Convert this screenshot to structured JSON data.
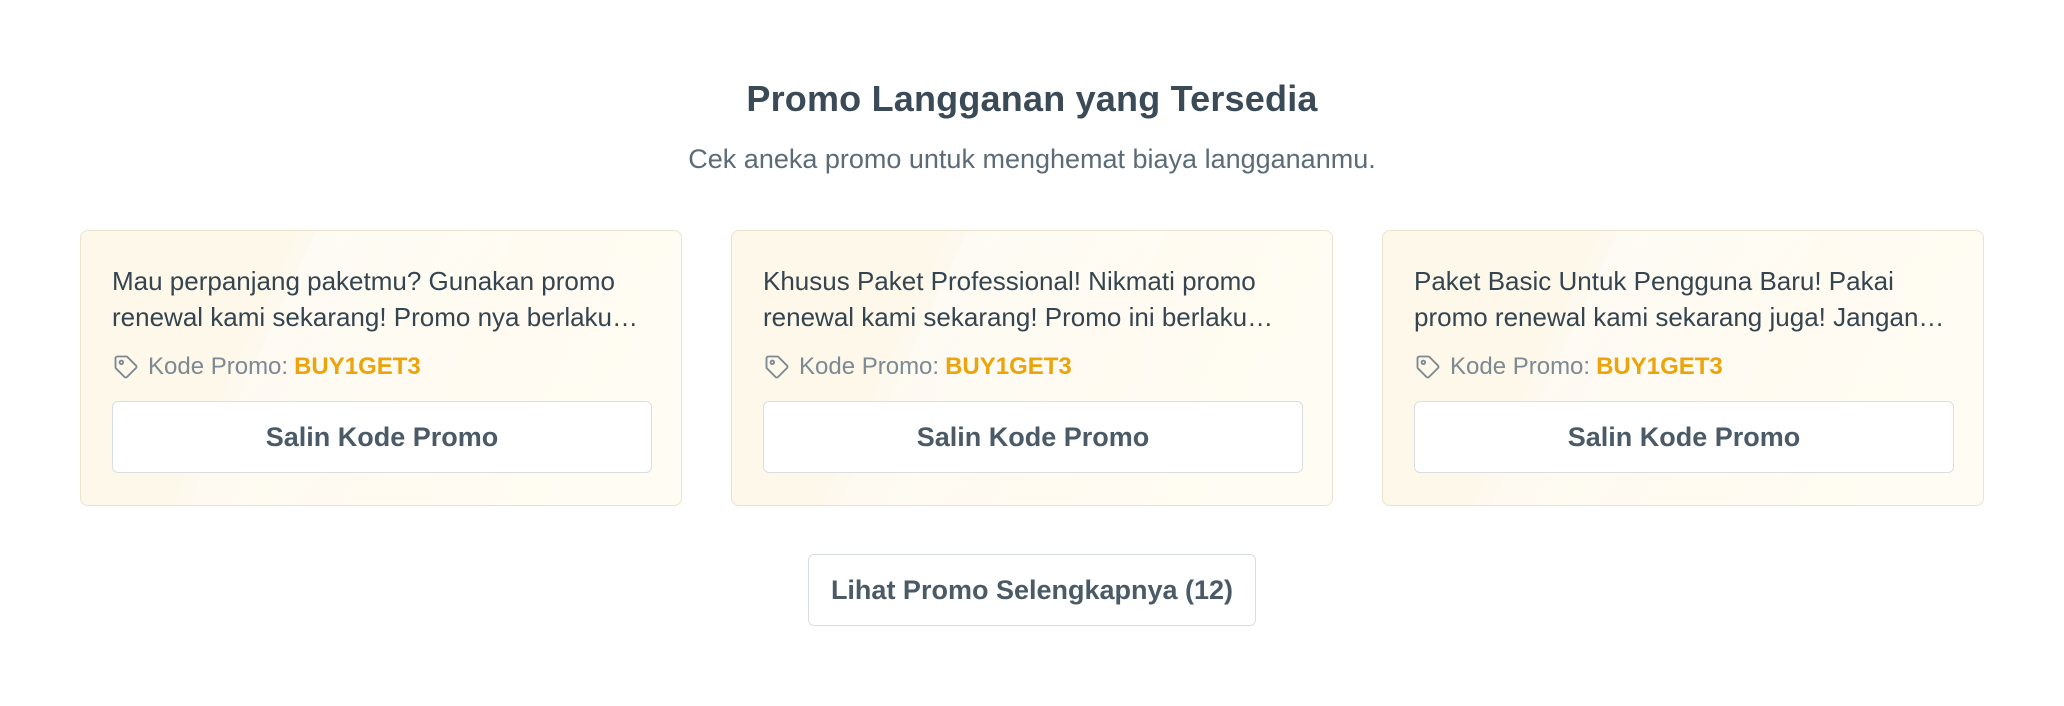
{
  "section": {
    "title": "Promo Langganan yang Tersedia",
    "subtitle": "Cek aneka promo untuk menghemat biaya langgananmu."
  },
  "promos": [
    {
      "description": "Mau perpanjang paketmu? Gunakan promo renewal kami sekarang! Promo nya berlaku untuk semua paket langganan.",
      "code_label": "Kode Promo:",
      "code": "BUY1GET3",
      "button_label": "Salin Kode Promo",
      "icon": "tag-icon"
    },
    {
      "description": "Khusus Paket Professional! Nikmati promo renewal kami sekarang! Promo ini berlaku terbatas.",
      "code_label": "Kode Promo:",
      "code": "BUY1GET3",
      "button_label": "Salin Kode Promo",
      "icon": "tag-icon"
    },
    {
      "description": "Paket Basic Untuk Pengguna Baru! Pakai promo renewal kami sekarang juga! Jangan sampai terlewat.",
      "code_label": "Kode Promo:",
      "code": "BUY1GET3",
      "button_label": "Salin Kode Promo",
      "icon": "tag-icon"
    }
  ],
  "more_button": {
    "label": "Lihat Promo Selengkapnya (12)"
  },
  "colors": {
    "accent": "#eba40b",
    "card_background": "#fdf8ea",
    "text": "#3a4a56"
  }
}
